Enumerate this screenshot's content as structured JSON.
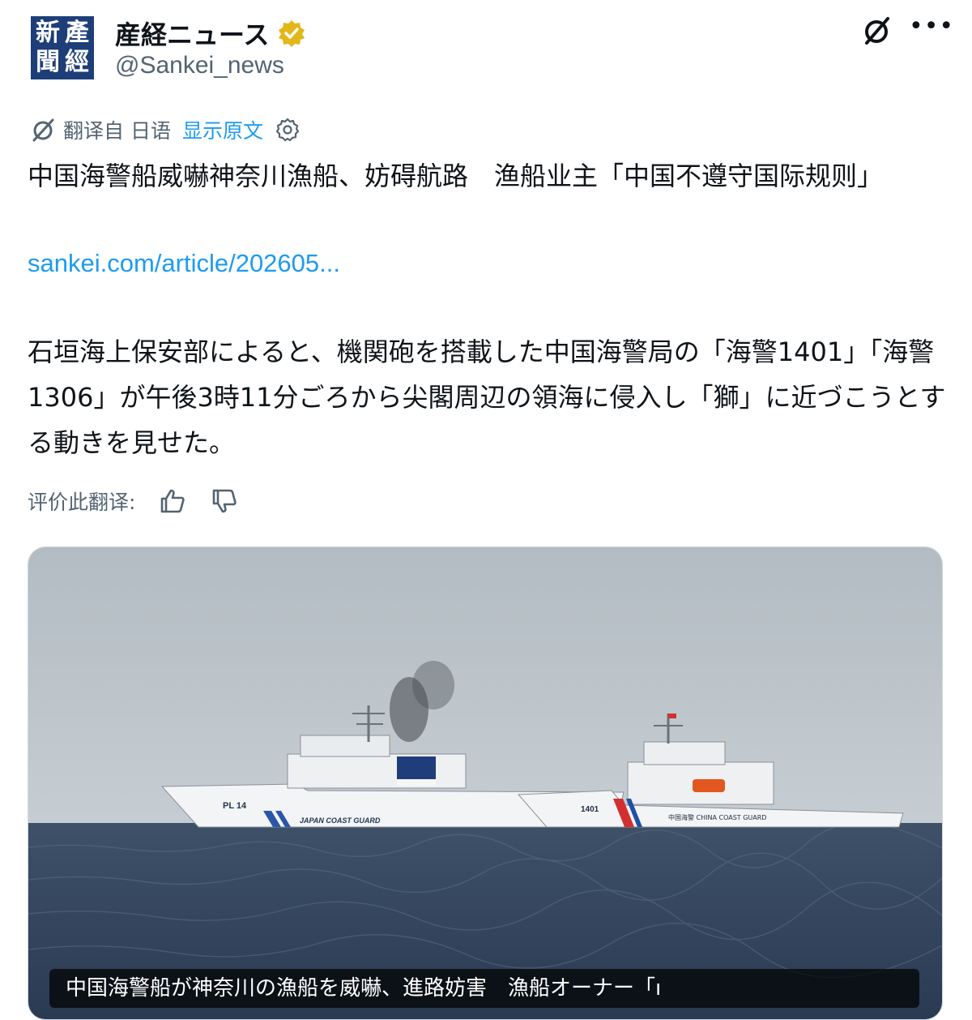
{
  "account": {
    "avatar_chars": [
      "新",
      "產",
      "聞",
      "經"
    ],
    "display_name": "産経ニュース",
    "handle": "@Sankei_news",
    "verified_color": "#e2b719"
  },
  "translation": {
    "label": "翻译自 日语",
    "show_original": "显示原文"
  },
  "tweet": {
    "text": "中国海警船威嚇神奈川漁船、妨碍航路　渔船业主「中国不遵守国际规则」",
    "link": "sankei.com/article/202605...",
    "body": "石垣海上保安部によると、機関砲を搭載した中国海警局の「海警1401」「海警1306」が午後3時11分ごろから尖閣周辺の領海に侵入し「獅」に近づこうとする動きを見せた。"
  },
  "rate": {
    "label": "评价此翻译:"
  },
  "media": {
    "caption": "中国海警船が神奈川の漁船を威嚇、進路妨害　漁船オーナー「ı",
    "ship1_hull_number": "PL 14",
    "ship1_hull_text": "JAPAN COAST GUARD",
    "ship2_hull_number": "1401",
    "ship2_hull_text": "中国海警 CHINA COAST GUARD"
  },
  "colors": {
    "link": "#1d9bf0",
    "secondary_text": "#536471",
    "avatar_bg": "#1d3e78"
  }
}
